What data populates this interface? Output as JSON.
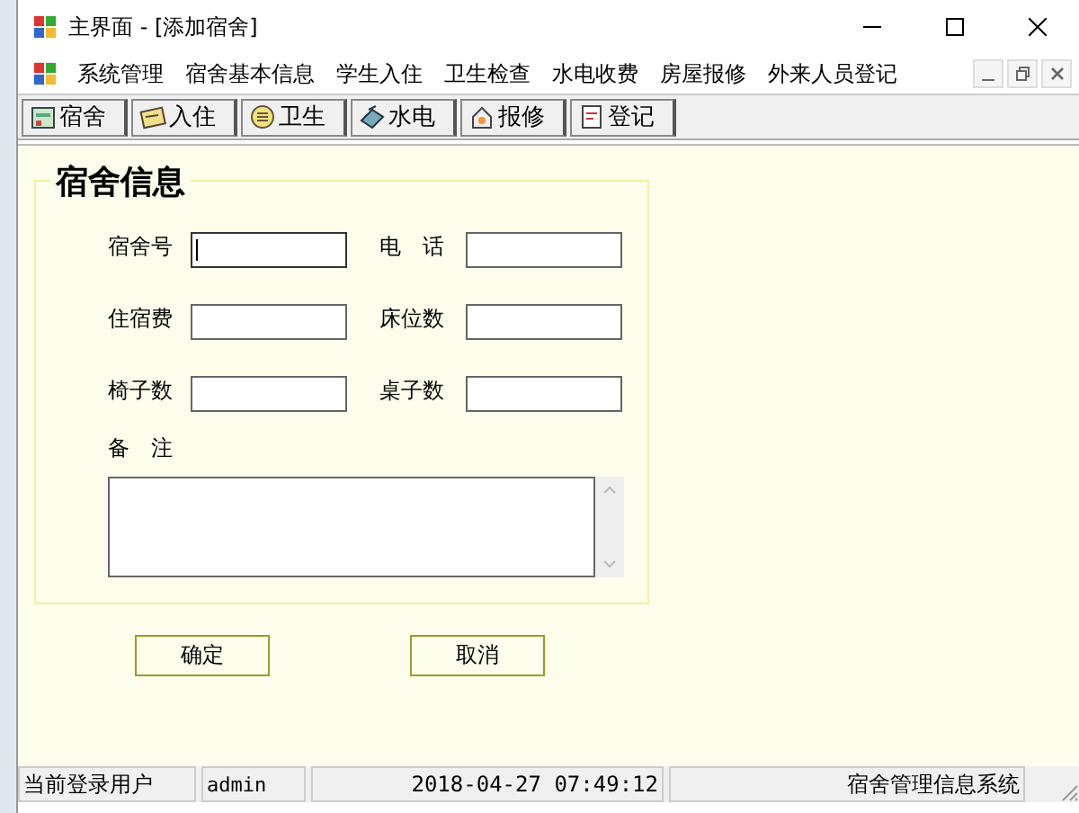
{
  "window": {
    "title": "主界面 - [添加宿舍]"
  },
  "menu": [
    "系统管理",
    "宿舍基本信息",
    "学生入住",
    "卫生检查",
    "水电收费",
    "房屋报修",
    "外来人员登记"
  ],
  "toolbar": [
    {
      "label": "宿舍",
      "kind": "dorm"
    },
    {
      "label": "入住",
      "kind": "checkin"
    },
    {
      "label": "卫生",
      "kind": "hygiene"
    },
    {
      "label": "水电",
      "kind": "utility"
    },
    {
      "label": "报修",
      "kind": "repair"
    },
    {
      "label": "登记",
      "kind": "register"
    }
  ],
  "group": {
    "title": "宿舍信息",
    "fields": [
      {
        "label": "宿舍号",
        "focused": true
      },
      {
        "label": "电　话",
        "focused": false
      },
      {
        "label": "住宿费",
        "focused": false
      },
      {
        "label": "床位数",
        "focused": false
      },
      {
        "label": "椅子数",
        "focused": false
      },
      {
        "label": "桌子数",
        "focused": false
      }
    ],
    "remark": {
      "label": "备　注"
    }
  },
  "buttons": [
    "确定",
    "取消"
  ],
  "status_bar": [
    "当前登录用户",
    "admin",
    "2018-04-27 07:49:12",
    "宿舍管理信息系统"
  ]
}
